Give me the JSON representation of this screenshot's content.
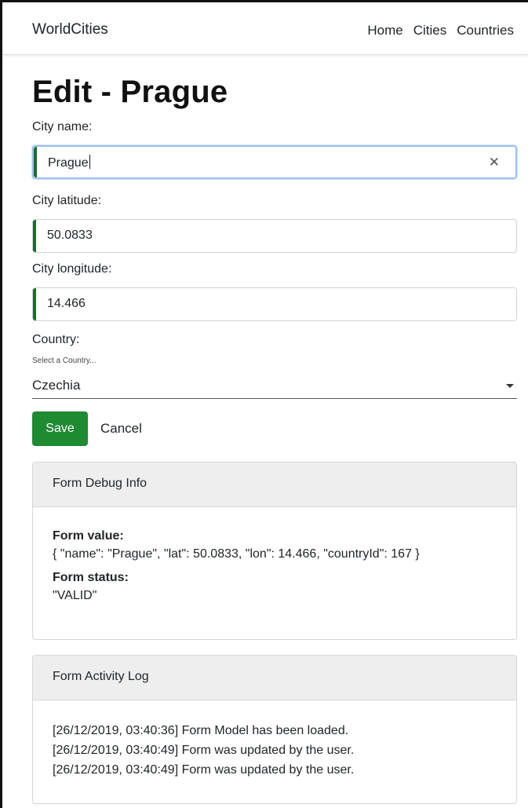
{
  "navbar": {
    "brand": "WorldCities",
    "links": [
      "Home",
      "Cities",
      "Countries"
    ]
  },
  "page": {
    "title": "Edit - Prague"
  },
  "form": {
    "name": {
      "label": "City name:",
      "value": "Prague"
    },
    "lat": {
      "label": "City latitude:",
      "value": "50.0833"
    },
    "lon": {
      "label": "City longitude:",
      "value": "14.466"
    },
    "country": {
      "label": "Country:",
      "hint": "Select a Country...",
      "value": "Czechia"
    },
    "save_label": "Save",
    "cancel_label": "Cancel"
  },
  "debug": {
    "title": "Form Debug Info",
    "value_label": "Form value:",
    "value": "{ \"name\": \"Prague\", \"lat\": 50.0833, \"lon\": 14.466, \"countryId\": 167 }",
    "status_label": "Form status:",
    "status": "\"VALID\""
  },
  "log": {
    "title": "Form Activity Log",
    "entries": [
      "[26/12/2019, 03:40:36] Form Model has been loaded.",
      "[26/12/2019, 03:40:49] Form was updated by the user.",
      "[26/12/2019, 03:40:49] Form was updated by the user."
    ]
  },
  "colors": {
    "save_button": "#1e8a32",
    "valid_indicator": "#1e6b2a",
    "focus_border": "#9cc3ef",
    "card_header_bg": "#eeeeee"
  },
  "icons": {
    "clear": "close-icon",
    "dropdown": "chevron-down-icon"
  }
}
